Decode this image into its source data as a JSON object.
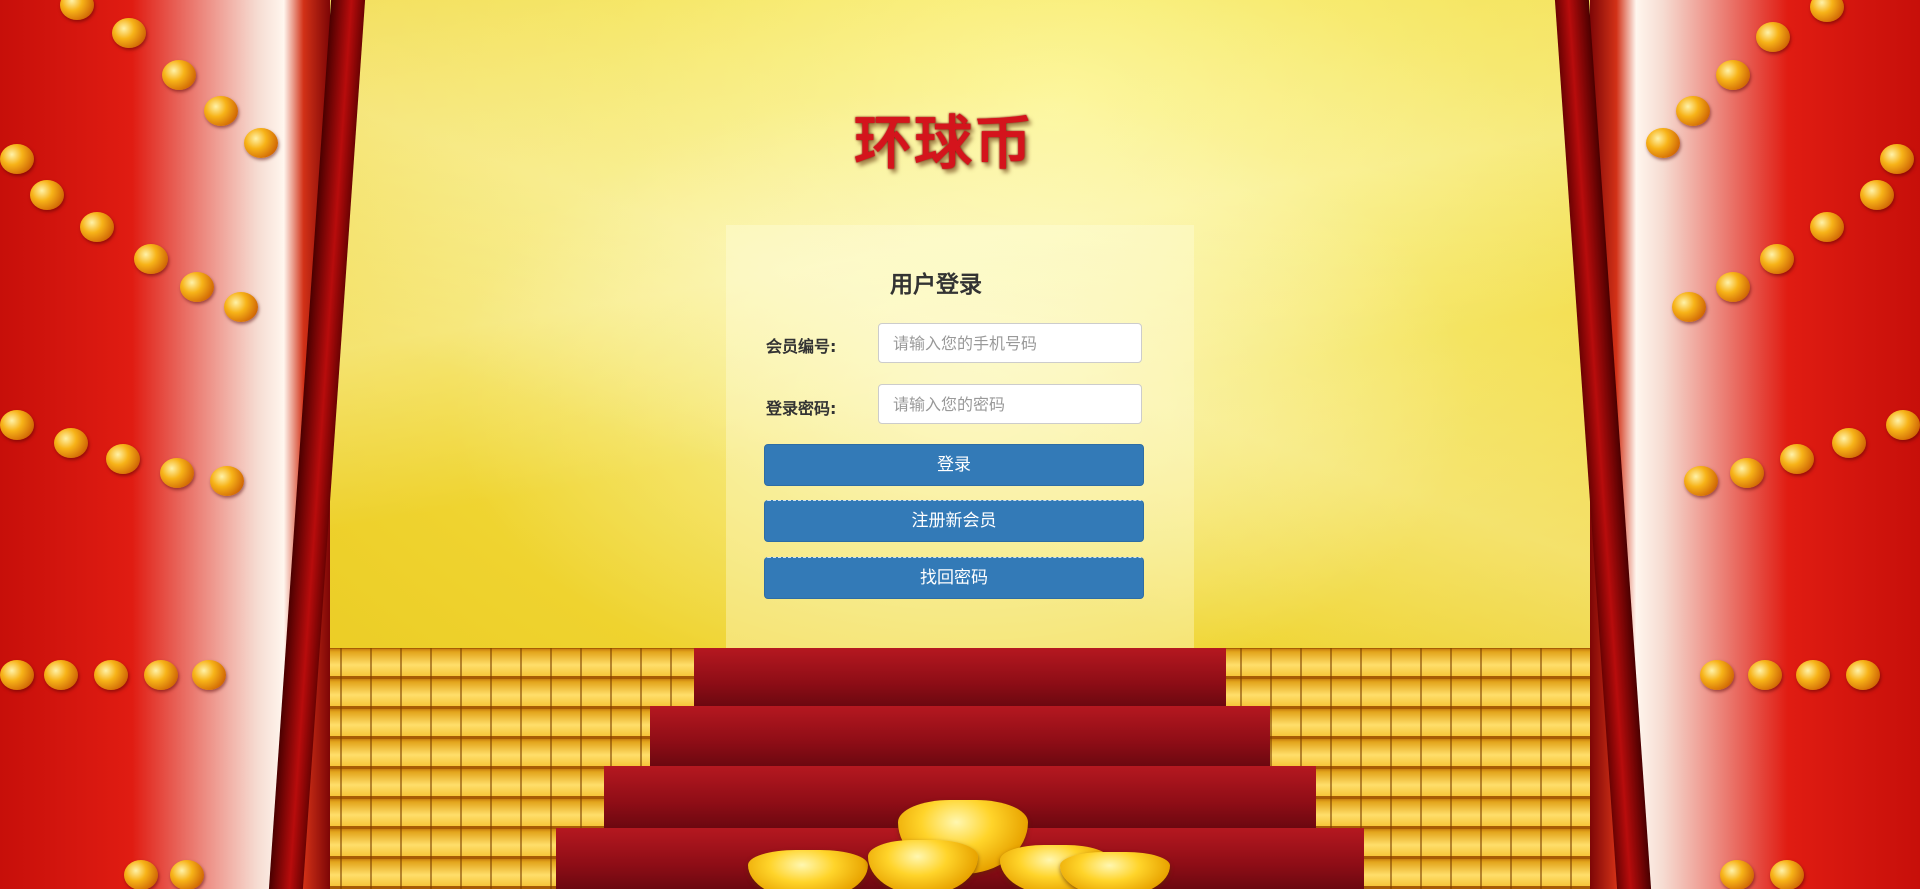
{
  "brand": {
    "title": "环球币"
  },
  "login": {
    "heading": "用户登录",
    "member_id_label": "会员编号:",
    "member_id_placeholder": "请输入您的手机号码",
    "member_id_value": "",
    "password_label": "登录密码:",
    "password_placeholder": "请输入您的密码",
    "password_value": "",
    "login_button": "登录",
    "register_button": "注册新会员",
    "recover_button": "找回密码"
  },
  "colors": {
    "brand_red": "#d4141c",
    "button_blue": "#337ab7",
    "door_red": "#e01c12",
    "gold": "#f7b318"
  },
  "decor": {
    "background_scene": "red palace doors, gold bricks and red carpet stairs with gold ingots"
  }
}
